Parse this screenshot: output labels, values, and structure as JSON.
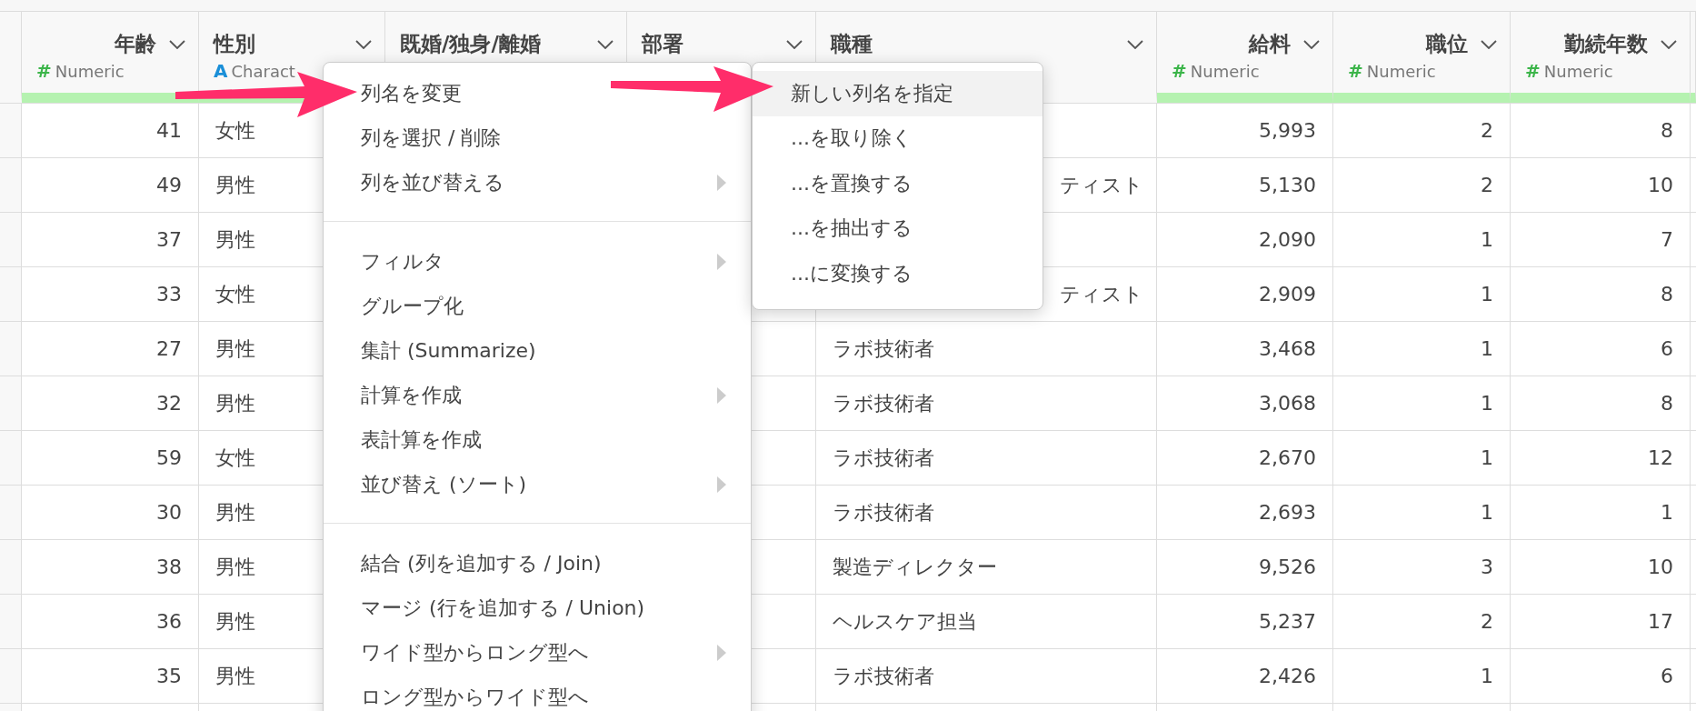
{
  "columns": [
    {
      "name": "年齢",
      "kind": "numeric",
      "type_icon": "#",
      "type_label": "Numeric"
    },
    {
      "name": "性別",
      "kind": "character",
      "type_icon": "A",
      "type_label": "Charact"
    },
    {
      "name": "既婚/独身/離婚",
      "kind": "other"
    },
    {
      "name": "部署",
      "kind": "other"
    },
    {
      "name": "職種",
      "kind": "other"
    },
    {
      "name": "給料",
      "kind": "numeric",
      "type_icon": "#",
      "type_label": "Numeric"
    },
    {
      "name": "職位",
      "kind": "numeric",
      "type_icon": "#",
      "type_label": "Numeric"
    },
    {
      "name": "勤続年数",
      "kind": "numeric",
      "type_icon": "#",
      "type_label": "Numeric"
    }
  ],
  "rows": [
    {
      "age": "41",
      "gender": "女性",
      "salary": "5,993",
      "rank": "2",
      "years": "8"
    },
    {
      "age": "49",
      "gender": "男性",
      "job": "ティスト",
      "job_cut": true,
      "salary": "5,130",
      "rank": "2",
      "years": "10"
    },
    {
      "age": "37",
      "gender": "男性",
      "salary": "2,090",
      "rank": "1",
      "years": "7"
    },
    {
      "age": "33",
      "gender": "女性",
      "job": "ティスト",
      "job_cut": true,
      "salary": "2,909",
      "rank": "1",
      "years": "8"
    },
    {
      "age": "27",
      "gender": "男性",
      "job": "ラボ技術者",
      "salary": "3,468",
      "rank": "1",
      "years": "6"
    },
    {
      "age": "32",
      "gender": "男性",
      "job": "ラボ技術者",
      "salary": "3,068",
      "rank": "1",
      "years": "8"
    },
    {
      "age": "59",
      "gender": "女性",
      "job": "ラボ技術者",
      "salary": "2,670",
      "rank": "1",
      "years": "12"
    },
    {
      "age": "30",
      "gender": "男性",
      "job": "ラボ技術者",
      "salary": "2,693",
      "rank": "1",
      "years": "1"
    },
    {
      "age": "38",
      "gender": "男性",
      "job": "製造ディレクター",
      "salary": "9,526",
      "rank": "3",
      "years": "10"
    },
    {
      "age": "36",
      "gender": "男性",
      "job": "ヘルスケア担当",
      "salary": "5,237",
      "rank": "2",
      "years": "17"
    },
    {
      "age": "35",
      "gender": "男性",
      "job": "ラボ技術者",
      "salary": "2,426",
      "rank": "1",
      "years": "6"
    }
  ],
  "menu": {
    "items": [
      {
        "kind": "item",
        "label": "列名を変更"
      },
      {
        "kind": "item",
        "label": "列を選択 / 削除"
      },
      {
        "kind": "item",
        "label": "列を並び替える",
        "has_submenu": true
      },
      {
        "kind": "separator"
      },
      {
        "kind": "item",
        "label": "フィルタ",
        "has_submenu": true
      },
      {
        "kind": "item",
        "label": "グループ化"
      },
      {
        "kind": "item",
        "label": "集計 (Summarize)"
      },
      {
        "kind": "item",
        "label": "計算を作成",
        "has_submenu": true
      },
      {
        "kind": "item",
        "label": "表計算を作成"
      },
      {
        "kind": "item",
        "label": "並び替え (ソート)",
        "has_submenu": true
      },
      {
        "kind": "separator"
      },
      {
        "kind": "item",
        "label": "結合 (列を追加する / Join)"
      },
      {
        "kind": "item",
        "label": "マージ (行を追加する / Union)"
      },
      {
        "kind": "item",
        "label": "ワイド型からロング型へ",
        "has_submenu": true
      },
      {
        "kind": "item",
        "label": "ロング型からワイド型へ"
      }
    ]
  },
  "submenu": {
    "items": [
      {
        "label": "新しい列名を指定",
        "selected": true
      },
      {
        "label": "...を取り除く",
        "selected": false
      },
      {
        "label": "...を置換する",
        "selected": false
      },
      {
        "label": "...を抽出する",
        "selected": false
      },
      {
        "label": "...に変換する",
        "selected": false
      }
    ]
  }
}
